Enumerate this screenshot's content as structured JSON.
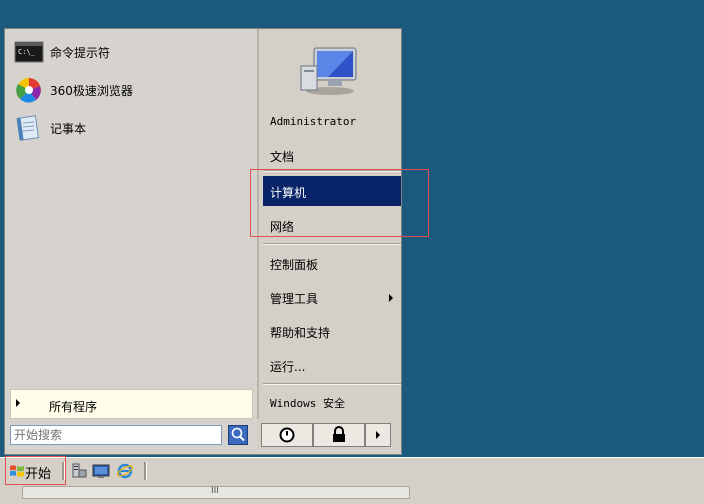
{
  "start_menu": {
    "pinned_apps": [
      {
        "label": "命令提示符",
        "icon": "command-prompt-icon"
      },
      {
        "label": "360极速浏览器",
        "icon": "browser-360-icon"
      },
      {
        "label": "记事本",
        "icon": "notepad-icon"
      }
    ],
    "all_programs_label": "所有程序",
    "search_placeholder": "开始搜索",
    "user_icon": "computer-user-icon",
    "right_items": {
      "administrator": "Administrator",
      "documents": "文档",
      "computer": "计算机",
      "network": "网络",
      "control_panel": "控制面板",
      "admin_tools": "管理工具",
      "help": "帮助和支持",
      "run": "运行...",
      "security": "Windows 安全"
    },
    "selected_item": "计算机",
    "power_buttons": [
      "power-icon",
      "lock-icon",
      "arrow-right-icon"
    ]
  },
  "taskbar": {
    "start_label": "开始",
    "quick_launch": [
      "server-manager-icon",
      "show-desktop-icon",
      "internet-explorer-icon"
    ],
    "scrollbar_grip": "III"
  },
  "colors": {
    "desktop": "#1c5a7d",
    "selection": "#0a246a",
    "highlight_box": "#e05050"
  }
}
